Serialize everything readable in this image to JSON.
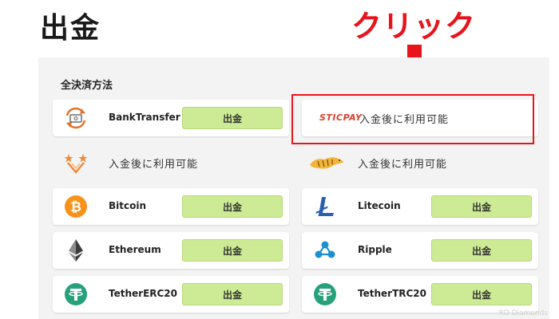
{
  "page": {
    "title": "出金"
  },
  "annotation": {
    "label": "クリック",
    "color": "#e8141b"
  },
  "section": {
    "title": "全決済方法"
  },
  "methods": [
    {
      "name": "BankTransfer",
      "button": "出金",
      "icon": "bank-transfer-icon"
    },
    {
      "name": "STICPAY",
      "note": "入金後に利用可能",
      "icon": "sticpay-logo"
    },
    {
      "note": "入金後に利用可能",
      "icon": "stars-wallet-icon"
    },
    {
      "note": "入金後に利用可能",
      "icon": "tiger-icon"
    },
    {
      "name": "Bitcoin",
      "button": "出金",
      "icon": "bitcoin-icon"
    },
    {
      "name": "Litecoin",
      "button": "出金",
      "icon": "litecoin-icon"
    },
    {
      "name": "Ethereum",
      "button": "出金",
      "icon": "ethereum-icon"
    },
    {
      "name": "Ripple",
      "button": "出金",
      "icon": "ripple-icon"
    },
    {
      "name": "TetherERC20",
      "button": "出金",
      "icon": "tether-icon"
    },
    {
      "name": "TetherTRC20",
      "button": "出金",
      "icon": "tether-icon"
    }
  ],
  "colors": {
    "button_bg": "#cdeb94",
    "bitcoin": "#f7931a",
    "litecoin": "#2a5fb0",
    "tether": "#26a17b",
    "ripple": "#1d8fcf",
    "sticpay": "#d9412b"
  },
  "watermark": "RD Diamonds"
}
